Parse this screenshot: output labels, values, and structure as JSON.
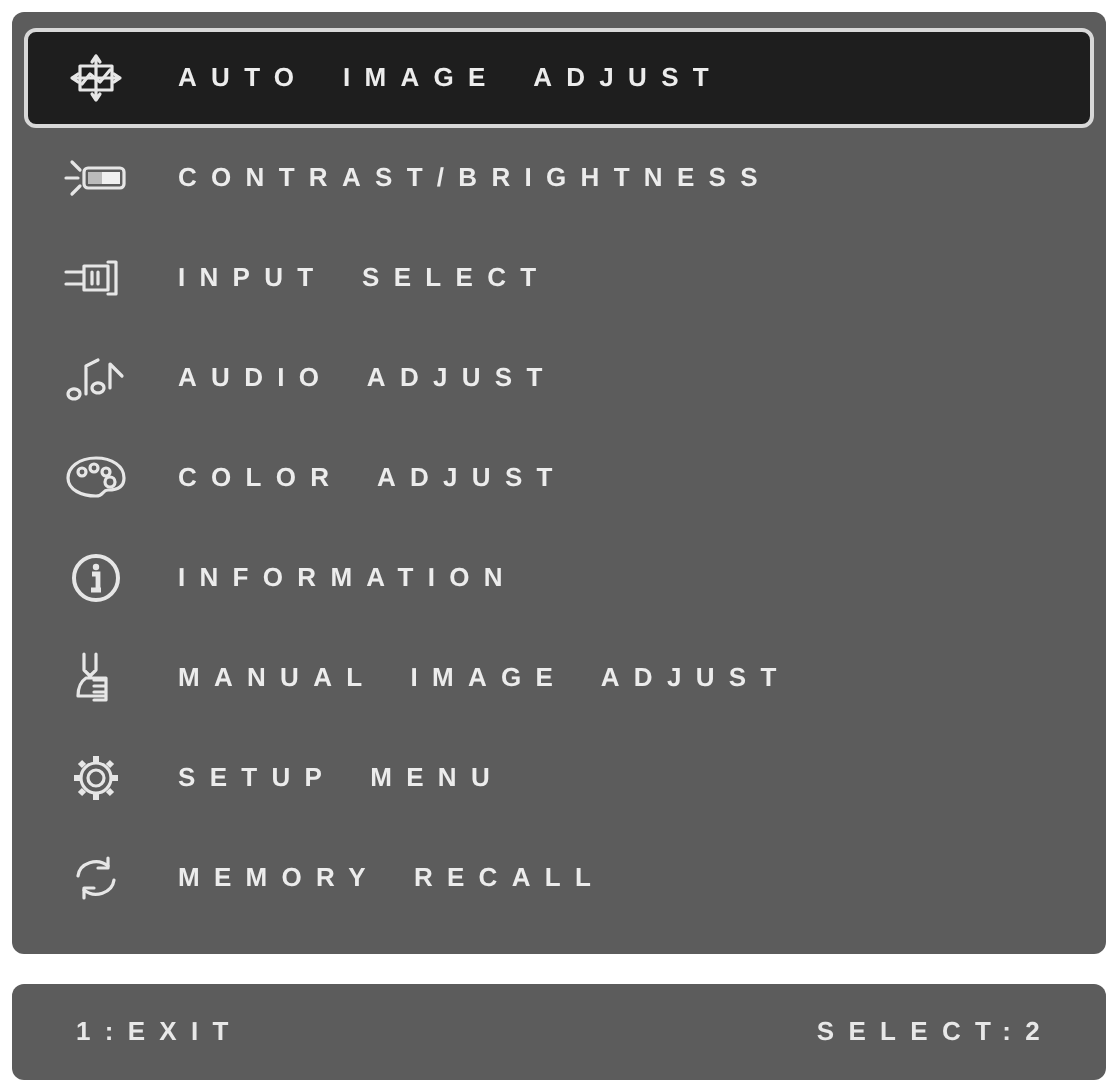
{
  "menu": {
    "items": [
      {
        "label": "AUTO IMAGE ADJUST",
        "selected": true
      },
      {
        "label": "CONTRAST/BRIGHTNESS",
        "selected": false
      },
      {
        "label": "INPUT SELECT",
        "selected": false
      },
      {
        "label": "AUDIO ADJUST",
        "selected": false
      },
      {
        "label": "COLOR ADJUST",
        "selected": false
      },
      {
        "label": "INFORMATION",
        "selected": false
      },
      {
        "label": "MANUAL IMAGE ADJUST",
        "selected": false
      },
      {
        "label": "SETUP MENU",
        "selected": false
      },
      {
        "label": "MEMORY RECALL",
        "selected": false
      }
    ]
  },
  "status_bar": {
    "left": "1:EXIT",
    "right": "SELECT:2"
  }
}
